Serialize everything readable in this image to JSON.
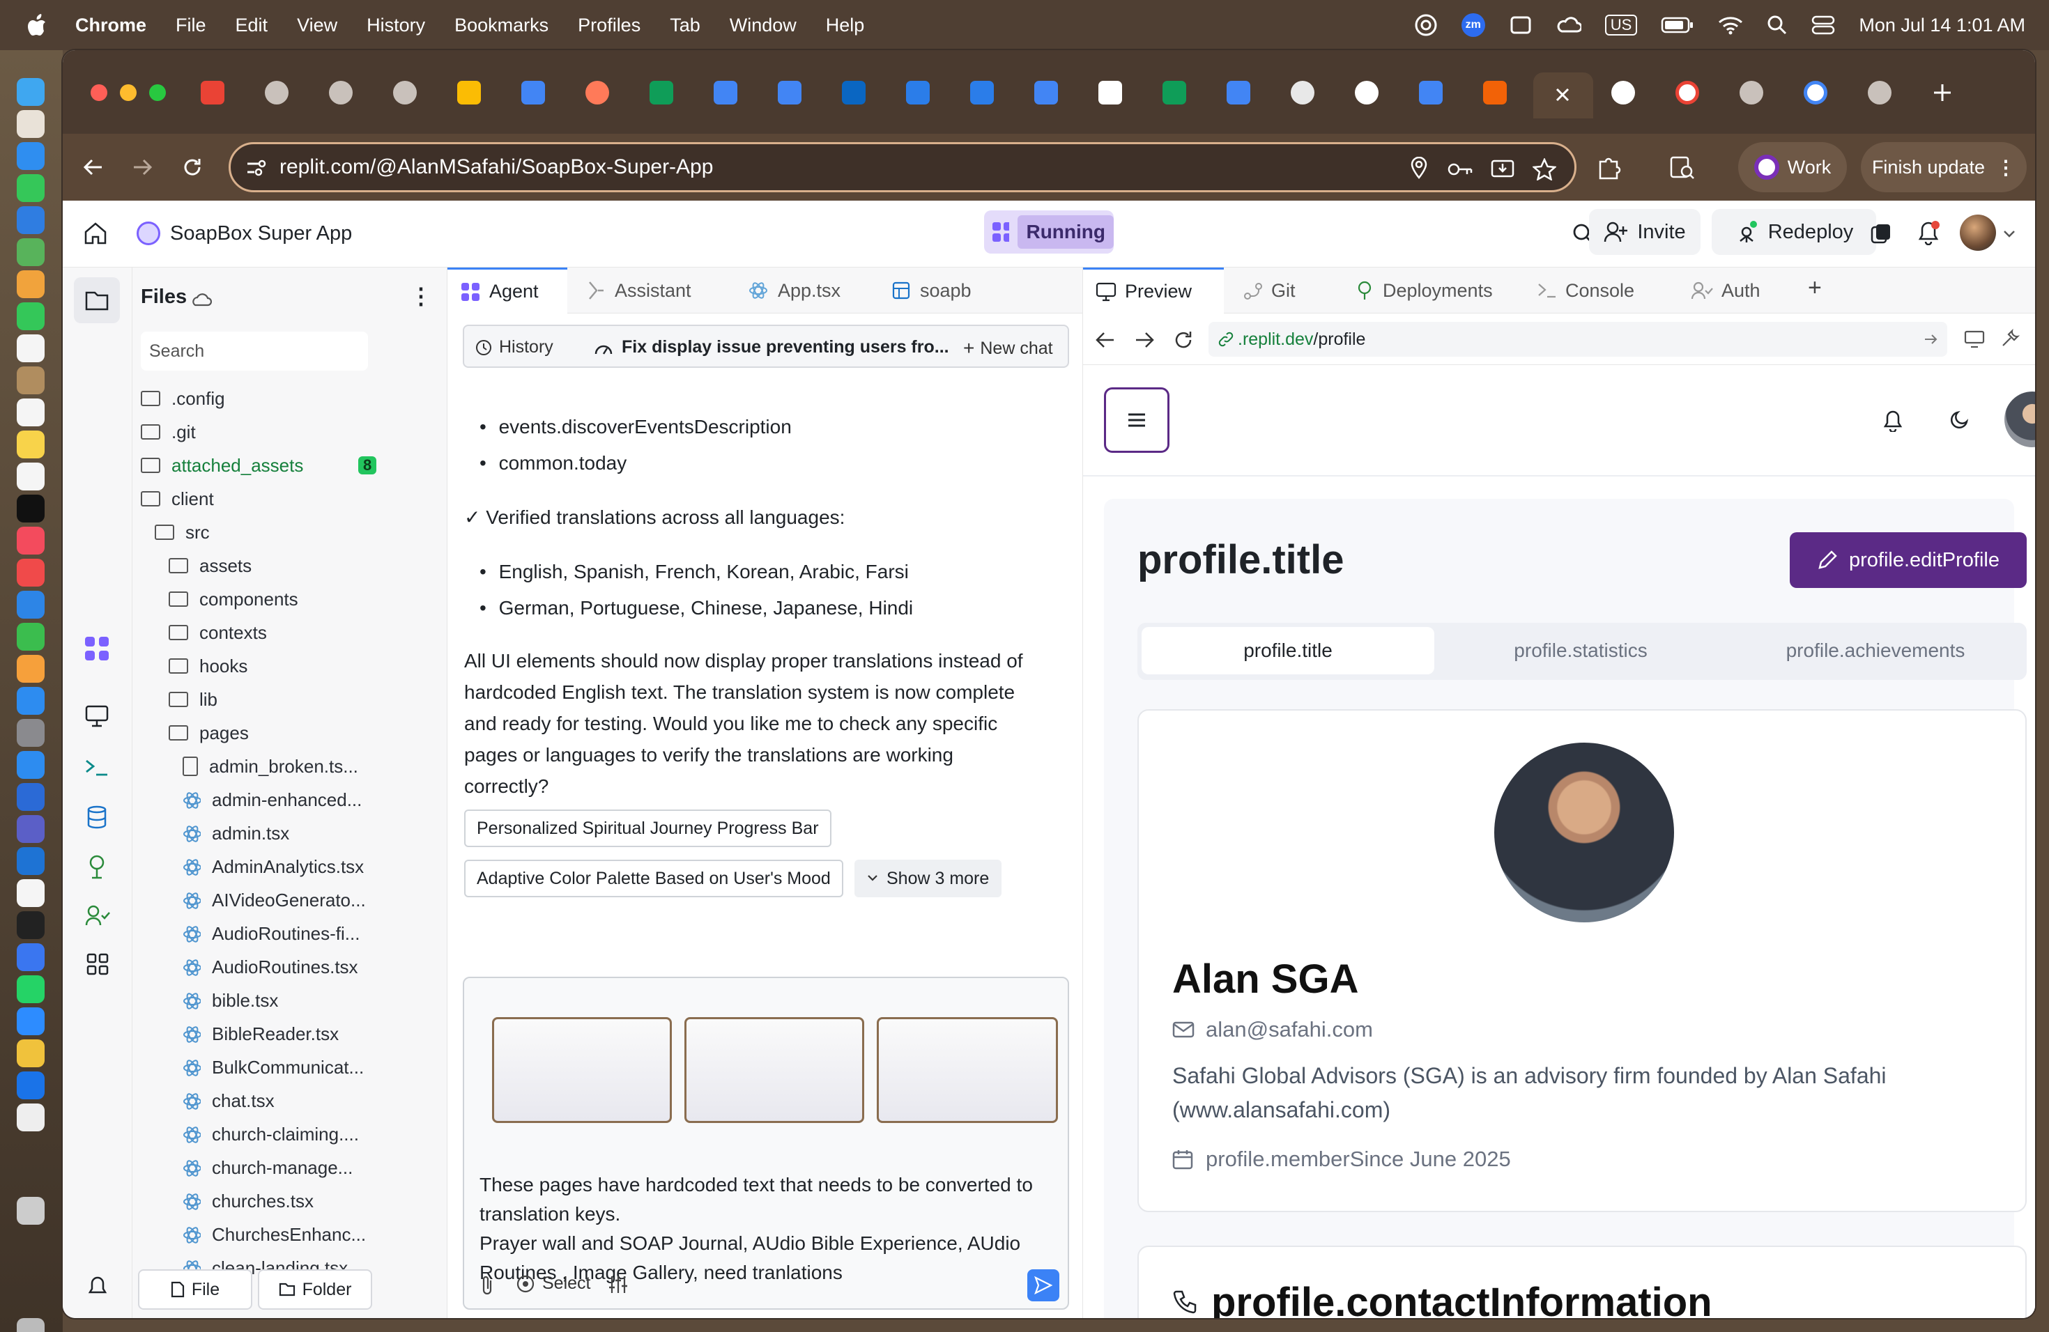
{
  "menubar": {
    "app": "Chrome",
    "items": [
      "File",
      "Edit",
      "View",
      "History",
      "Bookmarks",
      "Profiles",
      "Tab",
      "Window",
      "Help"
    ],
    "datetime": "Mon Jul 14  1:01 AM",
    "input_badge": "US",
    "zoom_badge": "zm"
  },
  "browser": {
    "url": "replit.com/@AlanMSafahi/SoapBox-Super-App",
    "profile_label": "Work",
    "update_label": "Finish update"
  },
  "replit": {
    "project_name": "SoapBox Super App",
    "status": "Running",
    "invite_label": "Invite",
    "redeploy_label": "Redeploy"
  },
  "files": {
    "title": "Files",
    "search_placeholder": "Search",
    "attached_count": "8",
    "new_file_label": "File",
    "new_folder_label": "Folder",
    "rows": [
      ".config",
      ".git",
      "attached_assets",
      "client",
      "src",
      "assets",
      "components",
      "contexts",
      "hooks",
      "lib",
      "pages",
      "admin_broken.ts...",
      "admin-enhanced...",
      "admin.tsx",
      "AdminAnalytics.tsx",
      "AIVideoGenerato...",
      "AudioRoutines-fi...",
      "AudioRoutines.tsx",
      "bible.tsx",
      "BibleReader.tsx",
      "BulkCommunicat...",
      "chat.tsx",
      "church-claiming....",
      "church-manage...",
      "churches.tsx",
      "ChurchesEnhanc...",
      "clean-landing.tsx"
    ]
  },
  "agent": {
    "tabs": [
      "Agent",
      "Assistant",
      "App.tsx",
      "soapb"
    ],
    "history_label": "History",
    "chat_title": "Fix display issue preventing users fro...",
    "new_chat_label": "New chat",
    "bullets1": [
      "events.discoverEventsDescription",
      "common.today"
    ],
    "verified": "✓ Verified translations across all languages:",
    "bullets2": [
      "English, Spanish, French, Korean, Arabic, Farsi",
      "German, Portuguese, Chinese, Japanese, Hindi"
    ],
    "paragraph_lines": [
      "All UI elements should now display proper translations instead of",
      "hardcoded English text. The translation system is now complete",
      "and ready for testing. Would you like me to check any specific",
      "pages or languages to verify the translations are working",
      "correctly?"
    ],
    "suggestions": [
      "Personalized Spiritual Journey Progress Bar",
      "Adaptive Color Palette Based on User's Mood"
    ],
    "show_more": "Show 3 more",
    "draft_lines": [
      "These pages have hardcoded text that needs to be converted to",
      "translation keys.",
      "Prayer wall and SOAP Journal, AUdio Bible Experience, AUdio",
      "Routines , Image Gallery, need tranlations"
    ],
    "select_label": "Select"
  },
  "preview": {
    "tabs": [
      "Preview",
      "Git",
      "Deployments",
      "Console",
      "Auth"
    ],
    "url_host": ".replit.dev",
    "url_path": "/profile",
    "page_title": "profile.title",
    "edit_button": "profile.editProfile",
    "subtabs": [
      "profile.title",
      "profile.statistics",
      "profile.achievements"
    ],
    "name": "Alan SGA",
    "email": "alan@safahi.com",
    "bio_lines": [
      "Safahi Global Advisors (SGA) is an advisory firm founded by Alan Safahi",
      "(www.alansafahi.com)"
    ],
    "member_since": "profile.memberSince June 2025",
    "contact_heading": "profile.contactInformation"
  },
  "colors": {
    "accent_purple": "#5b2a86",
    "running_bg": "#c9b8f0",
    "link_green": "#16803c",
    "badge_green": "#22c55e",
    "tab_blue": "#3b82f6"
  }
}
